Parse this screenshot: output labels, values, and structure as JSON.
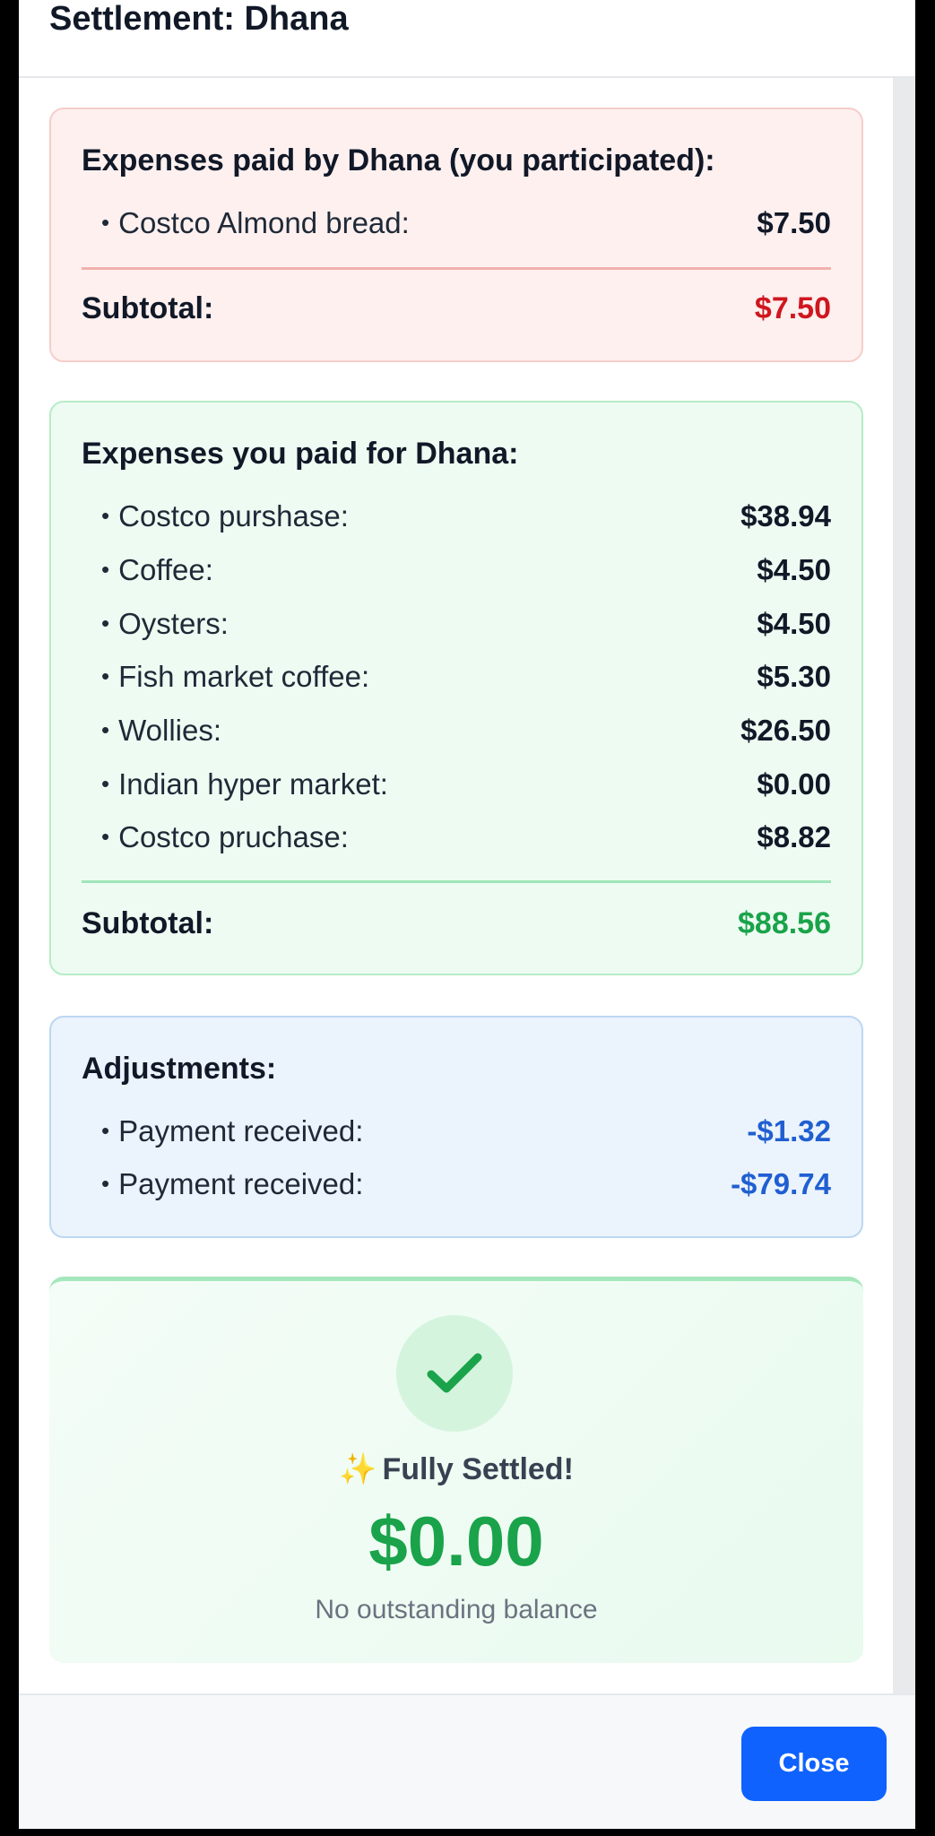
{
  "modal": {
    "title": "Settlement: Dhana"
  },
  "paid_by_other": {
    "heading": "Expenses paid by Dhana (you participated):",
    "items": [
      {
        "label": "Costco Almond bread:",
        "amount": "$7.50"
      }
    ],
    "subtotal_label": "Subtotal:",
    "subtotal_amount": "$7.50",
    "accent_color": "#d0161e"
  },
  "paid_by_you": {
    "heading": "Expenses you paid for Dhana:",
    "items": [
      {
        "label": "Costco purshase:",
        "amount": "$38.94"
      },
      {
        "label": "Coffee:",
        "amount": "$4.50"
      },
      {
        "label": "Oysters:",
        "amount": "$4.50"
      },
      {
        "label": "Fish market coffee:",
        "amount": "$5.30"
      },
      {
        "label": "Wollies:",
        "amount": "$26.50"
      },
      {
        "label": "Indian hyper market:",
        "amount": "$0.00"
      },
      {
        "label": "Costco pruchase:",
        "amount": "$8.82"
      }
    ],
    "subtotal_label": "Subtotal:",
    "subtotal_amount": "$88.56",
    "accent_color": "#1aa34a"
  },
  "adjustments": {
    "heading": "Adjustments:",
    "items": [
      {
        "label": "Payment received:",
        "amount": "-$1.32"
      },
      {
        "label": "Payment received:",
        "amount": "-$79.74"
      }
    ],
    "accent_color": "#1f5fd1"
  },
  "settled": {
    "icon": "check-icon",
    "sparkle": "✨",
    "title": "Fully Settled!",
    "amount": "$0.00",
    "subtitle": "No outstanding balance"
  },
  "footer": {
    "close_label": "Close"
  }
}
